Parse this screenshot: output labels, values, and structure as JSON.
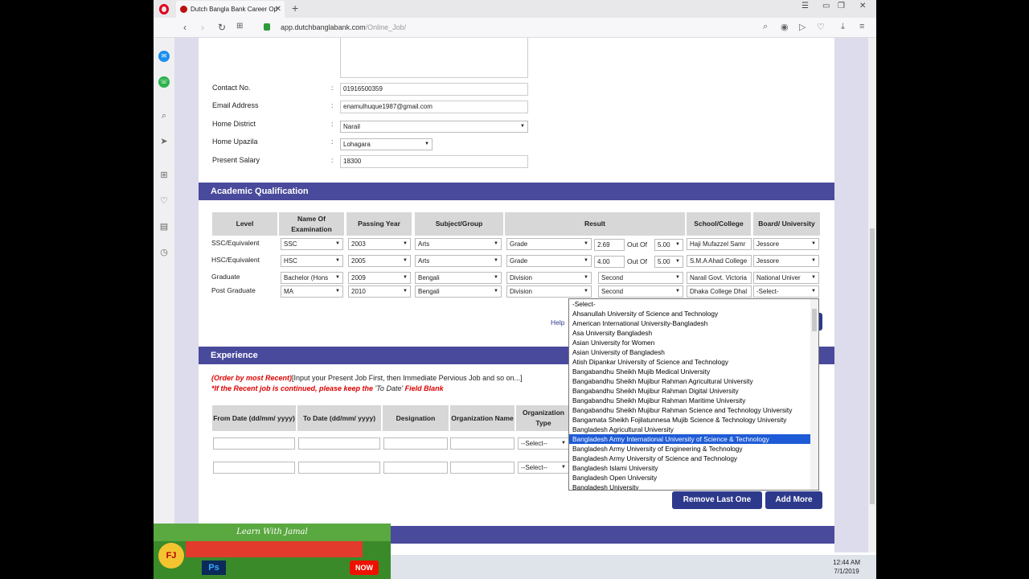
{
  "browser": {
    "tab_title": "Dutch Bangla Bank Career Op",
    "url_domain": "app.dutchbanglabank.com",
    "url_path": "/Online_Job/"
  },
  "personal": {
    "rows": [
      {
        "label": "Contact No.",
        "value": "01916500359",
        "kind": "text"
      },
      {
        "label": "Email Address",
        "value": "enamulhuque1987@gmail.com",
        "kind": "text"
      },
      {
        "label": "Home District",
        "value": "Narail",
        "kind": "select"
      },
      {
        "label": "Home Upazila",
        "value": "Lohagara",
        "kind": "select"
      },
      {
        "label": "Present Salary",
        "value": "18300",
        "kind": "text"
      }
    ],
    "colon": ":"
  },
  "academic": {
    "title": "Academic Qualification",
    "headers": {
      "level": "Level",
      "exam": "Name Of Examination",
      "year": "Passing Year",
      "subject": "Subject/Group",
      "result": "Result",
      "school": "School/College",
      "board": "Board/ University"
    },
    "rows": [
      {
        "level": "SSC/Equivalent",
        "exam": "SSC",
        "year": "2003",
        "subject": "Arts",
        "rtype": "Grade",
        "gpa": "2.69",
        "outof": "Out Of",
        "scale": "5.00",
        "school": "Haji Mufazzel Samr",
        "board": "Jessore"
      },
      {
        "level": "HSC/Equivalent",
        "exam": "HSC",
        "year": "2005",
        "subject": "Arts",
        "rtype": "Grade",
        "gpa": "4.00",
        "outof": "Out Of",
        "scale": "5.00",
        "school": "S.M.A Ahad College",
        "board": "Jessore"
      },
      {
        "level": "Graduate",
        "exam": "Bachelor (Hons",
        "year": "2009",
        "subject": "Bengali",
        "rtype": "Division",
        "division": "Second",
        "school": "Narail Govt. Victoria",
        "board": "National Univer"
      },
      {
        "level": "Post Graduate",
        "exam": "MA",
        "year": "2010",
        "subject": "Bengali",
        "rtype": "Division",
        "division": "Second",
        "school": "Dhaka College Dhal",
        "board": "-Select-"
      }
    ],
    "help_label": "Help"
  },
  "university_dropdown": {
    "options": [
      "-Select-",
      "Ahsanullah University of Science and Technology",
      "American International University-Bangladesh",
      "Asa University Bangladesh",
      "Asian University for Women",
      "Asian University of Bangladesh",
      "Atish Dipankar University of Science and Technology",
      "Bangabandhu Sheikh Mujib Medical University",
      "Bangabandhu Sheikh Mujibur Rahman Agricultural University",
      "Bangabandhu Sheikh Mujibur Rahman Digital University",
      "Bangabandhu Sheikh Mujibur Rahman Maritime University",
      "Bangabandhu Sheikh Mujibur Rahman Science and Technology University",
      "Bangamata Sheikh Fojilatunnesa Mujib Science & Technology University",
      "Bangladesh Agricultural University",
      "Bangladesh Army International University of Science & Technology",
      "Bangladesh Army University of Engineering & Technology",
      "Bangladesh Army University of Science and Technology",
      "Bangladesh Islami University",
      "Bangladesh Open University",
      "Bangladesh University"
    ],
    "highlighted_index": 14
  },
  "experience": {
    "title": "Experience",
    "note1_red": "(Order by most Recent)",
    "note1_rest": "[Input your Present Job First, then Immediate Pervious Job and so on...]",
    "note2_a": "*If the Recent job is continued, please keep the ",
    "note2_b": "'To Date'",
    "note2_c": " Field Blank",
    "headers": {
      "from": "From Date (dd/mm/ yyyy)",
      "to": "To Date (dd/mm/ yyyy)",
      "designation": "Designation",
      "org_name": "Organization Name",
      "org_type": "Organization Type"
    },
    "select_placeholder": "--Select--",
    "remove_label": "Remove Last One",
    "add_label": "Add More"
  },
  "taskbar": {
    "time": "12:44 AM",
    "date": "7/1/2019"
  },
  "watermark": {
    "tagline": "Learn With Jamal",
    "badge": "Ps",
    "yt": "NOW",
    "logo": "FJ"
  }
}
